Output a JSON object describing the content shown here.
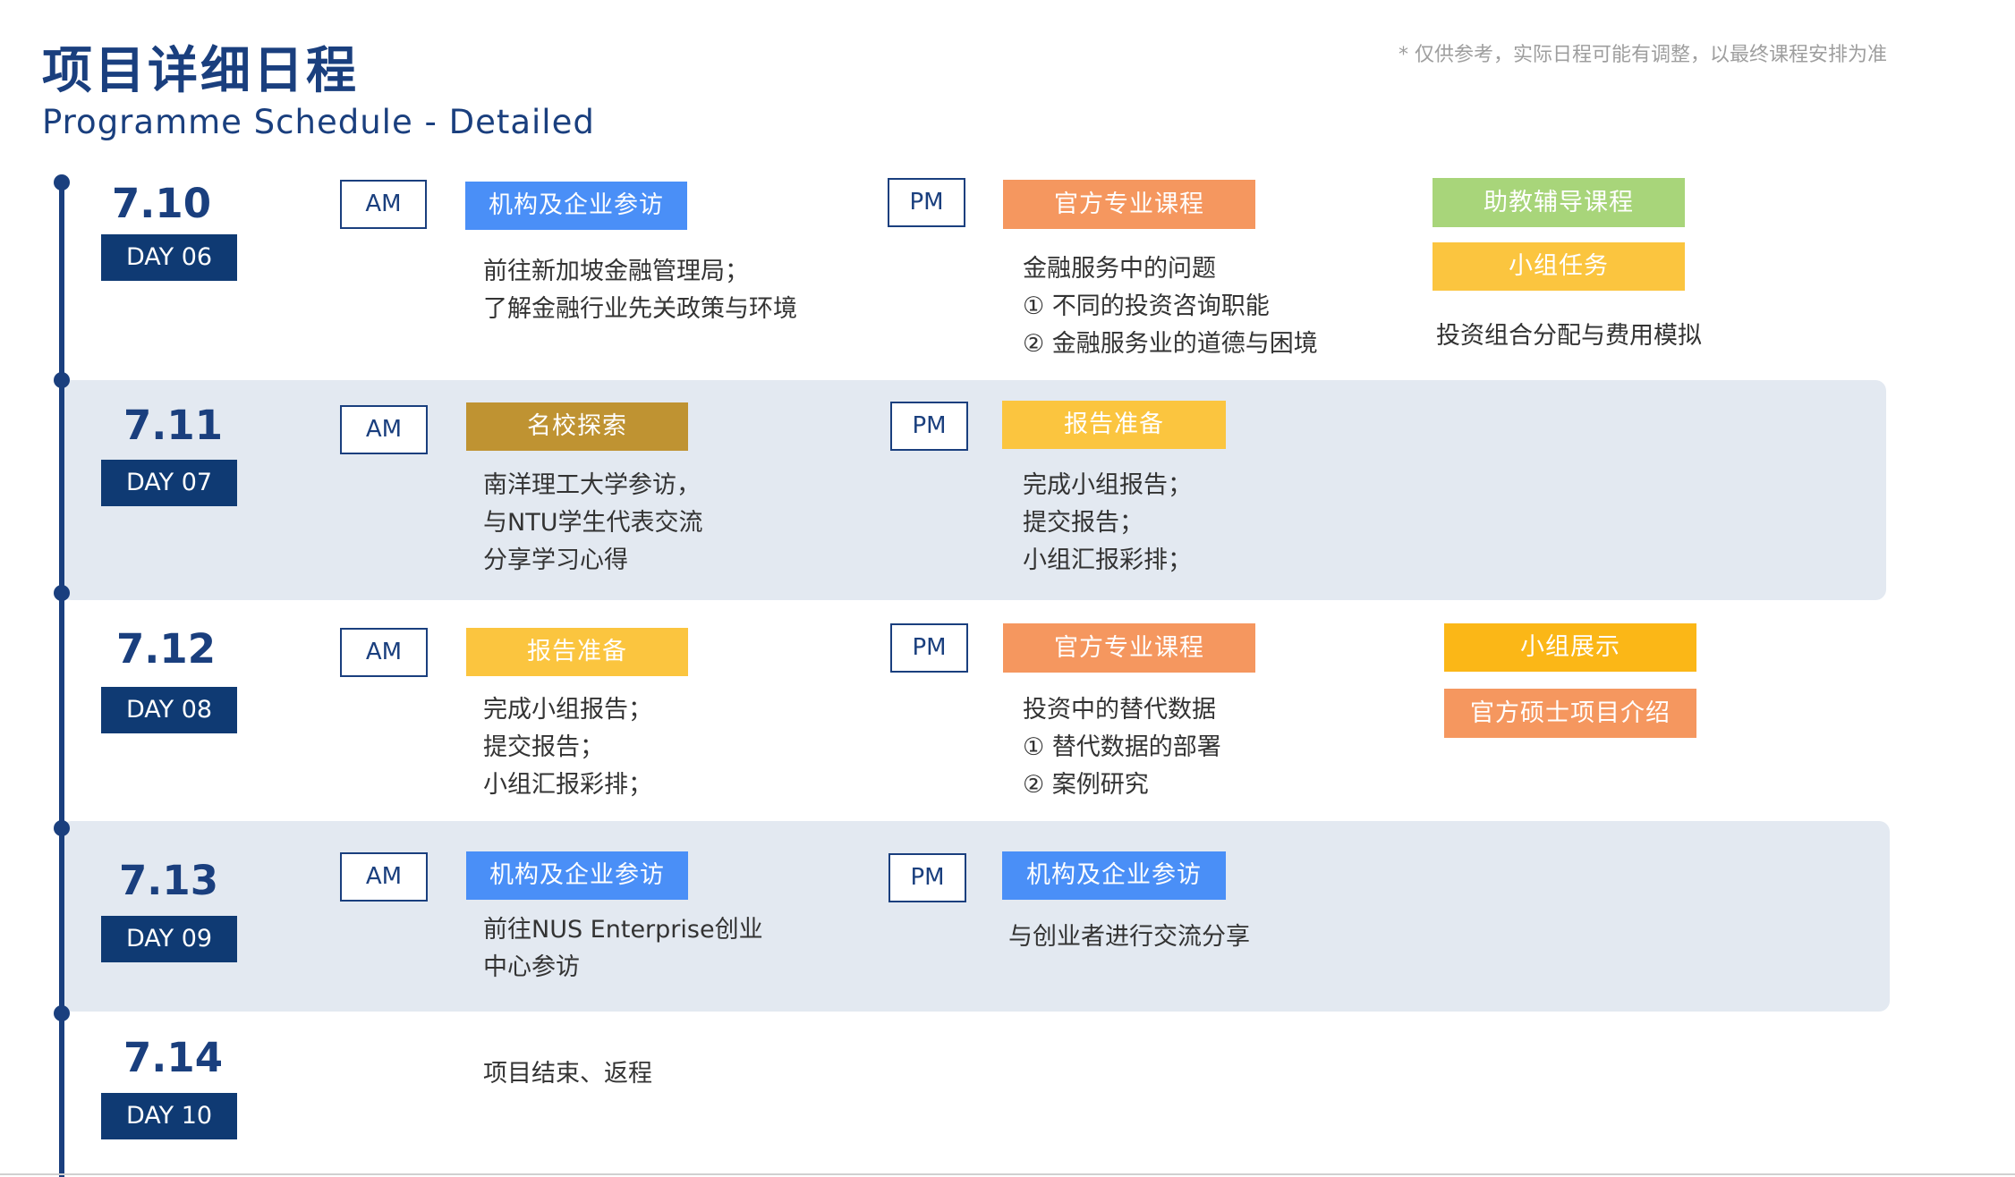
{
  "header": {
    "title_cn": "项目详细日程",
    "title_en": "Programme Schedule - Detailed",
    "note": "* 仅供参考，实际日程可能有调整，以最终课程安排为准"
  },
  "colors": {
    "navy": "#1a3f7e",
    "day_badge": "#0f3a73",
    "band": "#e3e9f1",
    "tag_blue": "#4a8ff7",
    "tag_orange": "#f5975f",
    "tag_green": "#a8d57a",
    "tag_yellow": "#fbc53f",
    "tag_gold": "#bf9332",
    "tag_amber": "#fbb717"
  },
  "days": [
    {
      "date": "7.10",
      "day": "DAY 06",
      "am_label": "AM",
      "am_tag": "机构及企业参访",
      "am_lines": [
        "前往新加坡金融管理局；",
        "了解金融行业先关政策与环境"
      ],
      "pm_label": "PM",
      "pm_tag": "官方专业课程",
      "pm_lines": [
        "金融服务中的问题",
        "① 不同的投资咨询职能",
        "② 金融服务业的道德与困境"
      ],
      "extra_tags": [
        "助教辅导课程",
        "小组任务"
      ],
      "extra_lines": [
        "投资组合分配与费用模拟"
      ]
    },
    {
      "date": "7.11",
      "day": "DAY 07",
      "am_label": "AM",
      "am_tag": "名校探索",
      "am_lines": [
        "南洋理工大学参访，",
        "与NTU学生代表交流",
        "分享学习心得"
      ],
      "pm_label": "PM",
      "pm_tag": "报告准备",
      "pm_lines": [
        "完成小组报告；",
        "提交报告；",
        "小组汇报彩排；"
      ]
    },
    {
      "date": "7.12",
      "day": "DAY 08",
      "am_label": "AM",
      "am_tag": "报告准备",
      "am_lines": [
        "完成小组报告；",
        "提交报告；",
        "小组汇报彩排；"
      ],
      "pm_label": "PM",
      "pm_tag": "官方专业课程",
      "pm_lines": [
        "投资中的替代数据",
        "① 替代数据的部署",
        "② 案例研究"
      ],
      "extra_tags": [
        "小组展示",
        "官方硕士项目介绍"
      ]
    },
    {
      "date": "7.13",
      "day": "DAY 09",
      "am_label": "AM",
      "am_tag": "机构及企业参访",
      "am_lines": [
        "前往NUS Enterprise创业",
        "中心参访"
      ],
      "pm_label": "PM",
      "pm_tag": "机构及企业参访",
      "pm_lines": [
        "与创业者进行交流分享"
      ]
    },
    {
      "date": "7.14",
      "day": "DAY 10",
      "am_lines": [
        "项目结束、返程"
      ]
    }
  ]
}
